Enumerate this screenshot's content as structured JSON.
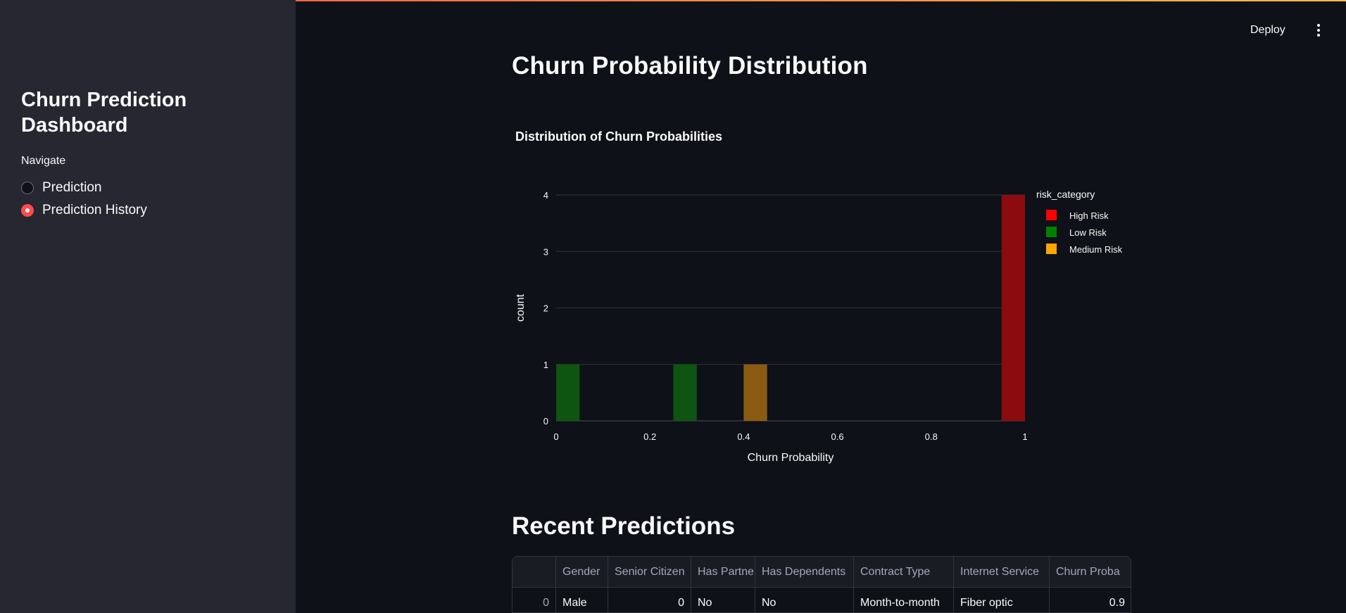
{
  "sidebar": {
    "title": "Churn Prediction Dashboard",
    "nav_label": "Navigate",
    "options": [
      {
        "label": "Prediction",
        "selected": false
      },
      {
        "label": "Prediction History",
        "selected": true
      }
    ]
  },
  "header": {
    "deploy_label": "Deploy",
    "menu_icon": "kebab-menu-icon"
  },
  "main": {
    "section_title": "Churn Probability Distribution",
    "table_title": "Recent Predictions"
  },
  "colors": {
    "accent": "#ff4b4b",
    "high_risk": "#ff0000",
    "low_risk": "#008000",
    "medium_risk": "#ffa500"
  },
  "chart_data": {
    "type": "bar",
    "title": "Distribution of Churn Probabilities",
    "xlabel": "Churn Probability",
    "ylabel": "count",
    "xlim": [
      0,
      1
    ],
    "ylim": [
      0,
      4
    ],
    "x_ticks": [
      "0",
      "0.2",
      "0.4",
      "0.6",
      "0.8",
      "1"
    ],
    "y_ticks": [
      "0",
      "1",
      "2",
      "3",
      "4"
    ],
    "legend_title": "risk_category",
    "legend_position": "top-right",
    "bin_width": 0.05,
    "series": [
      {
        "name": "High Risk",
        "color": "#ff0000",
        "bins": [
          {
            "start": 0.95,
            "count": 4
          }
        ]
      },
      {
        "name": "Low Risk",
        "color": "#008000",
        "bins": [
          {
            "start": 0.0,
            "count": 1
          },
          {
            "start": 0.25,
            "count": 1
          }
        ]
      },
      {
        "name": "Medium Risk",
        "color": "#ffa500",
        "bins": [
          {
            "start": 0.4,
            "count": 1
          }
        ]
      }
    ]
  },
  "table": {
    "columns": [
      "",
      "Gender",
      "Senior Citizen",
      "Has Partner",
      "Has Dependents",
      "Contract Type",
      "Internet Service",
      "Churn Proba"
    ],
    "rows": [
      [
        "0",
        "Male",
        "0",
        "No",
        "No",
        "Month-to-month",
        "Fiber optic",
        "0.9"
      ]
    ]
  }
}
